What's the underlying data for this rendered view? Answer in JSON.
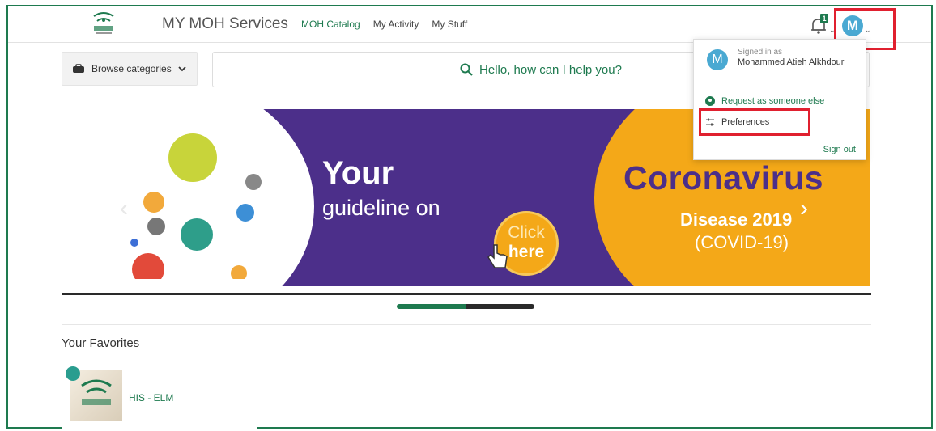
{
  "header": {
    "app_title": "MY MOH Services",
    "nav": [
      "MOH Catalog",
      "My Activity",
      "My Stuff"
    ],
    "notification_count": "1",
    "avatar_initial": "M"
  },
  "toolbar": {
    "browse_label": "Browse categories",
    "search_placeholder": "Hello, how can I help you?"
  },
  "banner": {
    "title": "Your",
    "subtitle": "guideline on",
    "click_line1": "Click",
    "click_line2": "here",
    "headline": "Coronavirus",
    "disease": "Disease 2019",
    "covid": "(COVID-19)"
  },
  "favorites": {
    "heading": "Your Favorites",
    "items": [
      {
        "label": "HIS - ELM"
      }
    ]
  },
  "user_menu": {
    "signed_in_as": "Signed in as",
    "name": "Mohammed Atieh Alkhdour",
    "request_label": "Request as someone else",
    "preferences_label": "Preferences",
    "sign_out_label": "Sign out"
  },
  "colors": {
    "brand_green": "#1e7a4f",
    "banner_purple": "#4c2f8a",
    "banner_yellow": "#f4a818",
    "highlight_red": "#e0202f"
  }
}
